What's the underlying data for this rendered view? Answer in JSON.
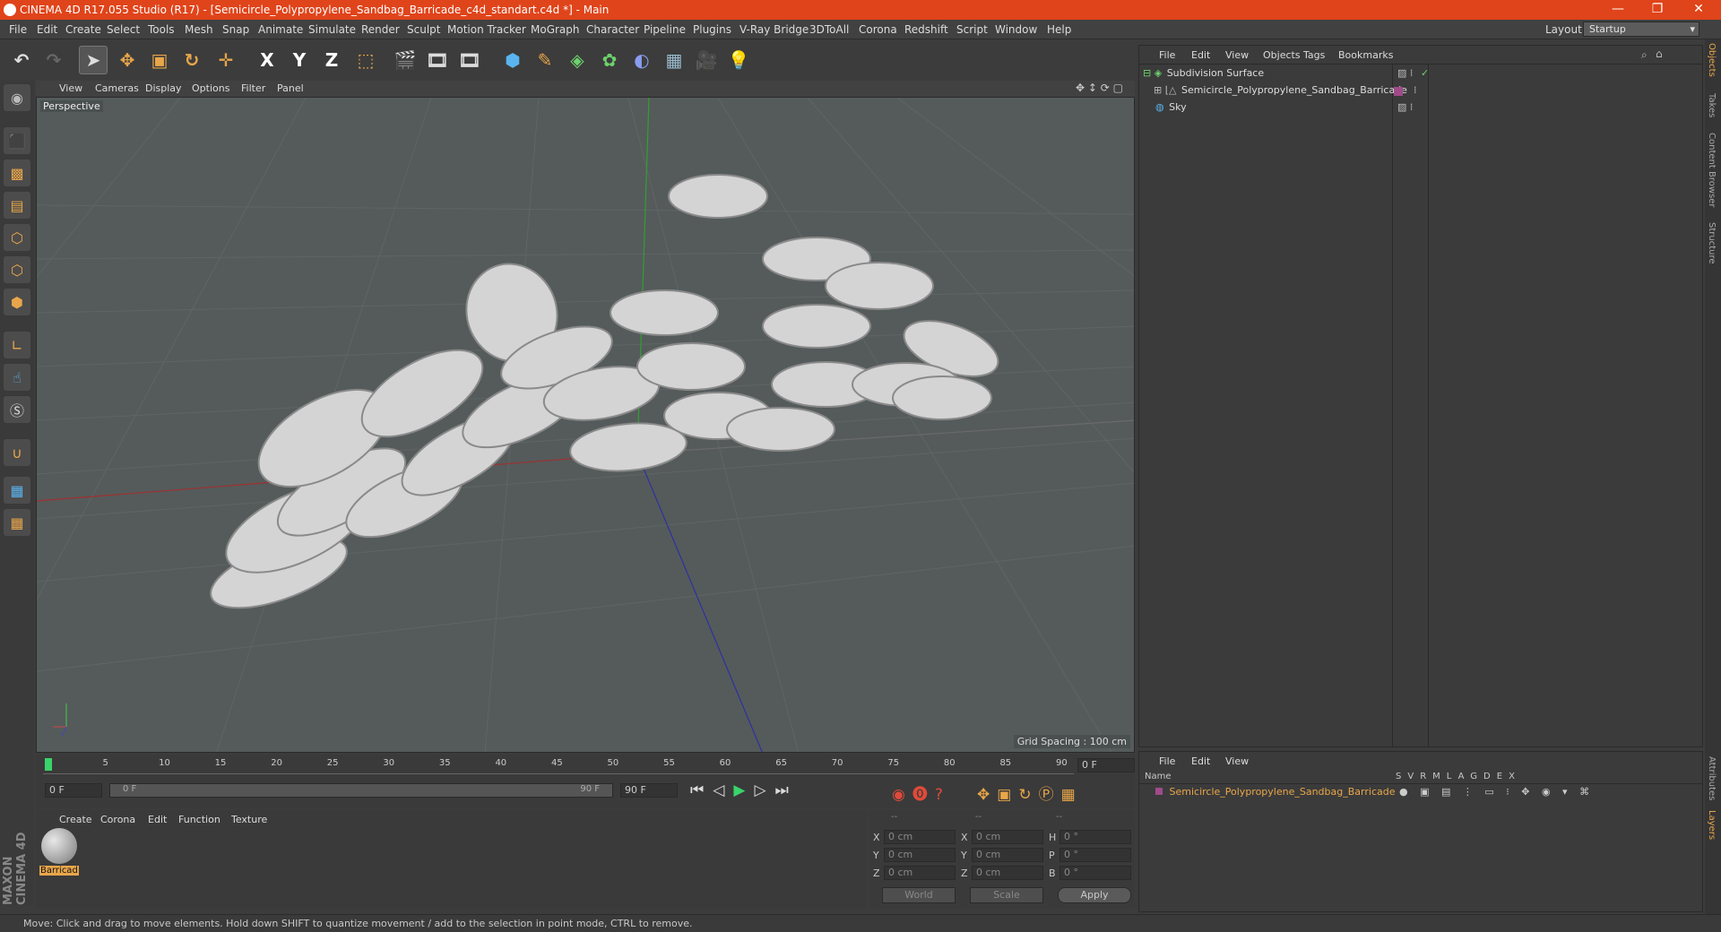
{
  "window": {
    "title": "CINEMA 4D R17.055 Studio (R17) - [Semicircle_Polypropylene_Sandbag_Barricade_c4d_standart.c4d *] - Main",
    "controls": [
      "—",
      "❐",
      "✕"
    ]
  },
  "menubar": {
    "items": [
      "File",
      "Edit",
      "Create",
      "Select",
      "Tools",
      "Mesh",
      "Snap",
      "Animate",
      "Simulate",
      "Render",
      "Sculpt",
      "Motion Tracker",
      "MoGraph",
      "Character",
      "Pipeline",
      "Plugins",
      "V-Ray Bridge",
      "3DToAll",
      "Corona",
      "Redshift",
      "Script",
      "Window",
      "Help"
    ],
    "layout_label": "Layout:",
    "layout_value": "Startup"
  },
  "toolbar": {
    "axis": [
      "X",
      "Y",
      "Z"
    ]
  },
  "viewport": {
    "menu": [
      "View",
      "Cameras",
      "Display",
      "Options",
      "Filter",
      "Panel"
    ],
    "label": "Perspective",
    "grid_spacing": "Grid Spacing : 100 cm"
  },
  "timeline": {
    "ticks": [
      "0",
      "5",
      "10",
      "15",
      "20",
      "25",
      "30",
      "35",
      "40",
      "45",
      "50",
      "55",
      "60",
      "65",
      "70",
      "75",
      "80",
      "85",
      "90"
    ],
    "current_frame": "0 F",
    "start_field": "0 F",
    "range_start": "0 F",
    "range_end": "90 F",
    "end_field": "90 F"
  },
  "materials": {
    "menu": [
      "Create",
      "Corona",
      "Edit",
      "Function",
      "Texture"
    ],
    "items": [
      {
        "name": "Barricad"
      }
    ]
  },
  "coords": {
    "headers": [
      "--",
      "--",
      "--"
    ],
    "rows": [
      {
        "a": "X",
        "av": "0 cm",
        "b": "X",
        "bv": "0 cm",
        "c": "H",
        "cv": "0 °"
      },
      {
        "a": "Y",
        "av": "0 cm",
        "b": "Y",
        "bv": "0 cm",
        "c": "P",
        "cv": "0 °"
      },
      {
        "a": "Z",
        "av": "0 cm",
        "b": "Z",
        "bv": "0 cm",
        "c": "B",
        "cv": "0 °"
      }
    ],
    "world": "World",
    "scale": "Scale",
    "apply": "Apply"
  },
  "objects": {
    "menu": [
      "File",
      "Edit",
      "View",
      "Objects",
      "Tags",
      "Bookmarks"
    ],
    "items": [
      {
        "name": "Subdivision Surface"
      },
      {
        "name": "Semicircle_Polypropylene_Sandbag_Barricade"
      },
      {
        "name": "Sky"
      }
    ]
  },
  "layers": {
    "menu": [
      "File",
      "Edit",
      "View"
    ],
    "columns_label": "Name",
    "flags": [
      "S",
      "V",
      "R",
      "M",
      "L",
      "A",
      "G",
      "D",
      "E",
      "X"
    ],
    "item": "Semicircle_Polypropylene_Sandbag_Barricade"
  },
  "right_tabs": [
    "Objects",
    "Takes",
    "Content Browser",
    "Structure"
  ],
  "right_tabs_bottom": [
    "Attributes",
    "Layers"
  ],
  "brand": "MAXON CINEMA 4D",
  "status": "Move: Click and drag to move elements. Hold down SHIFT to quantize movement / add to the selection in point mode, CTRL to remove."
}
